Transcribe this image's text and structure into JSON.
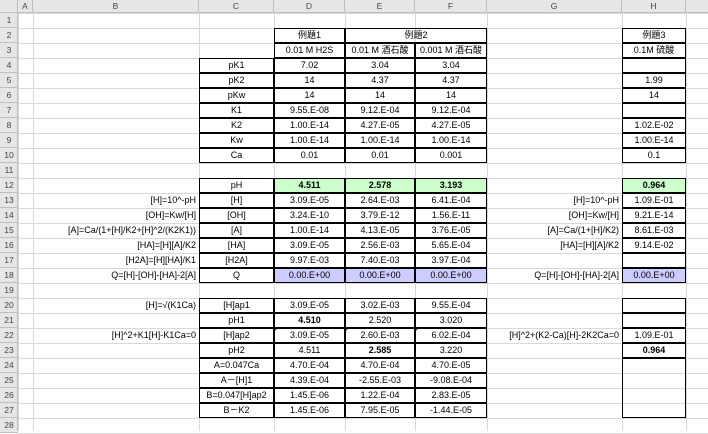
{
  "columns": [
    "A",
    "B",
    "C",
    "D",
    "E",
    "F",
    "G",
    "H"
  ],
  "rows": [
    "1",
    "2",
    "3",
    "4",
    "5",
    "6",
    "7",
    "8",
    "9",
    "10",
    "11",
    "12",
    "13",
    "14",
    "15",
    "16",
    "17",
    "18",
    "19",
    "20",
    "21",
    "22",
    "23",
    "24",
    "25",
    "26",
    "27",
    "28"
  ],
  "colors": {
    "green": "#ccffcc",
    "purple": "#ccccff",
    "comment_marker": "#1e7b34"
  },
  "cells": [
    {
      "ref": "D2",
      "text": "例題1",
      "align": "center"
    },
    {
      "ref": "E2",
      "text": "例題2",
      "align": "center",
      "span": 2
    },
    {
      "ref": "H2",
      "text": "例題3",
      "align": "center"
    },
    {
      "ref": "D3",
      "text": "0.01 M H2S",
      "align": "center"
    },
    {
      "ref": "E3",
      "text": "0.01 M 酒石酸",
      "align": "center"
    },
    {
      "ref": "F3",
      "text": "0.001 M 酒石酸",
      "align": "center"
    },
    {
      "ref": "H3",
      "text": "0.1M 硫酸",
      "align": "center"
    },
    {
      "ref": "C4",
      "text": "pK1",
      "align": "center"
    },
    {
      "ref": "D4",
      "text": "7.02",
      "align": "center"
    },
    {
      "ref": "E4",
      "text": "3.04",
      "align": "center"
    },
    {
      "ref": "F4",
      "text": "3.04",
      "align": "center"
    },
    {
      "ref": "C5",
      "text": "pK2",
      "align": "center"
    },
    {
      "ref": "D5",
      "text": "14",
      "align": "center"
    },
    {
      "ref": "E5",
      "text": "4.37",
      "align": "center"
    },
    {
      "ref": "F5",
      "text": "4.37",
      "align": "center"
    },
    {
      "ref": "H5",
      "text": "1.99",
      "align": "center"
    },
    {
      "ref": "C6",
      "text": "pKw",
      "align": "center"
    },
    {
      "ref": "D6",
      "text": "14",
      "align": "center"
    },
    {
      "ref": "E6",
      "text": "14",
      "align": "center"
    },
    {
      "ref": "F6",
      "text": "14",
      "align": "center"
    },
    {
      "ref": "H6",
      "text": "14",
      "align": "center"
    },
    {
      "ref": "C7",
      "text": "K1",
      "align": "center"
    },
    {
      "ref": "D7",
      "text": "9.55.E-08",
      "align": "center"
    },
    {
      "ref": "E7",
      "text": "9.12.E-04",
      "align": "center"
    },
    {
      "ref": "F7",
      "text": "9.12.E-04",
      "align": "center"
    },
    {
      "ref": "C8",
      "text": "K2",
      "align": "center"
    },
    {
      "ref": "D8",
      "text": "1.00.E-14",
      "align": "center"
    },
    {
      "ref": "E8",
      "text": "4.27.E-05",
      "align": "center"
    },
    {
      "ref": "F8",
      "text": "4.27.E-05",
      "align": "center"
    },
    {
      "ref": "H8",
      "text": "1.02.E-02",
      "align": "center"
    },
    {
      "ref": "C9",
      "text": "Kw",
      "align": "center"
    },
    {
      "ref": "D9",
      "text": "1.00.E-14",
      "align": "center"
    },
    {
      "ref": "E9",
      "text": "1.00.E-14",
      "align": "center"
    },
    {
      "ref": "F9",
      "text": "1.00.E-14",
      "align": "center"
    },
    {
      "ref": "H9",
      "text": "1.00.E-14",
      "align": "center"
    },
    {
      "ref": "C10",
      "text": "Ca",
      "align": "center"
    },
    {
      "ref": "D10",
      "text": "0.01",
      "align": "center"
    },
    {
      "ref": "E10",
      "text": "0.01",
      "align": "center"
    },
    {
      "ref": "F10",
      "text": "0.001",
      "align": "center"
    },
    {
      "ref": "H10",
      "text": "0.1",
      "align": "center"
    },
    {
      "ref": "C12",
      "text": "pH",
      "align": "center"
    },
    {
      "ref": "D12",
      "text": "4.511",
      "align": "center",
      "bold": true,
      "fill": "green"
    },
    {
      "ref": "E12",
      "text": "2.578",
      "align": "center",
      "bold": true,
      "fill": "green"
    },
    {
      "ref": "F12",
      "text": "3.193",
      "align": "center",
      "bold": true,
      "fill": "green"
    },
    {
      "ref": "H12",
      "text": "0.964",
      "align": "center",
      "bold": true,
      "fill": "green"
    },
    {
      "ref": "B13",
      "text": "[H]=10^-pH",
      "align": "right"
    },
    {
      "ref": "C13",
      "text": "[H]",
      "align": "center"
    },
    {
      "ref": "D13",
      "text": "3.09.E-05",
      "align": "center"
    },
    {
      "ref": "E13",
      "text": "2.64.E-03",
      "align": "center"
    },
    {
      "ref": "F13",
      "text": "6.41.E-04",
      "align": "center"
    },
    {
      "ref": "G13",
      "text": "[H]=10^-pH",
      "align": "right"
    },
    {
      "ref": "H13",
      "text": "1.09.E-01",
      "align": "center"
    },
    {
      "ref": "B14",
      "text": "[OH]=Kw/[H]",
      "align": "right"
    },
    {
      "ref": "C14",
      "text": "[OH]",
      "align": "center"
    },
    {
      "ref": "D14",
      "text": "3.24.E-10",
      "align": "center"
    },
    {
      "ref": "E14",
      "text": "3.79.E-12",
      "align": "center"
    },
    {
      "ref": "F14",
      "text": "1.56.E-11",
      "align": "center"
    },
    {
      "ref": "G14",
      "text": "[OH]=Kw/[H]",
      "align": "right"
    },
    {
      "ref": "H14",
      "text": "9.21.E-14",
      "align": "center"
    },
    {
      "ref": "B15",
      "text": "[A]=Ca/(1+[H]/K2+[H]^2/(K2K1))",
      "align": "right"
    },
    {
      "ref": "C15",
      "text": "[A]",
      "align": "center"
    },
    {
      "ref": "D15",
      "text": "1.00.E-14",
      "align": "center"
    },
    {
      "ref": "E15",
      "text": "4.13.E-05",
      "align": "center"
    },
    {
      "ref": "F15",
      "text": "3.76.E-05",
      "align": "center"
    },
    {
      "ref": "G15",
      "text": "[A]=Ca/(1+[H]/K2)",
      "align": "right"
    },
    {
      "ref": "H15",
      "text": "8.61.E-03",
      "align": "center"
    },
    {
      "ref": "B16",
      "text": "[HA]=[H][A]/K2",
      "align": "right"
    },
    {
      "ref": "C16",
      "text": "[HA]",
      "align": "center"
    },
    {
      "ref": "D16",
      "text": "3.09.E-05",
      "align": "center"
    },
    {
      "ref": "E16",
      "text": "2.56.E-03",
      "align": "center"
    },
    {
      "ref": "F16",
      "text": "5.65.E-04",
      "align": "center"
    },
    {
      "ref": "G16",
      "text": "[HA]=[H][A]/K2",
      "align": "right"
    },
    {
      "ref": "H16",
      "text": "9.14.E-02",
      "align": "center"
    },
    {
      "ref": "B17",
      "text": "[H2A]=[H][HA]/K1",
      "align": "right"
    },
    {
      "ref": "C17",
      "text": "[H2A]",
      "align": "center"
    },
    {
      "ref": "D17",
      "text": "9.97.E-03",
      "align": "center"
    },
    {
      "ref": "E17",
      "text": "7.40.E-03",
      "align": "center"
    },
    {
      "ref": "F17",
      "text": "3.97.E-04",
      "align": "center"
    },
    {
      "ref": "B18",
      "text": "Q=[H]-[OH]-[HA]-2[A]",
      "align": "right"
    },
    {
      "ref": "C18",
      "text": "Q",
      "align": "center"
    },
    {
      "ref": "D18",
      "text": "0.00.E+00",
      "align": "center",
      "fill": "purple"
    },
    {
      "ref": "E18",
      "text": "0.00.E+00",
      "align": "center",
      "fill": "purple"
    },
    {
      "ref": "F18",
      "text": "0.00.E+00",
      "align": "center",
      "fill": "purple"
    },
    {
      "ref": "G18",
      "text": "Q=[H]-[OH]-[HA]-2[A]",
      "align": "right"
    },
    {
      "ref": "H18",
      "text": "0.00.E+00",
      "align": "center",
      "fill": "purple"
    },
    {
      "ref": "B20",
      "text": "[H]=√(K1Ca)",
      "align": "right"
    },
    {
      "ref": "C20",
      "text": "[H]ap1",
      "align": "center"
    },
    {
      "ref": "D20",
      "text": "3.09.E-05",
      "align": "center"
    },
    {
      "ref": "E20",
      "text": "3.02.E-03",
      "align": "center"
    },
    {
      "ref": "F20",
      "text": "9.55.E-04",
      "align": "center"
    },
    {
      "ref": "C21",
      "text": "pH1",
      "align": "center"
    },
    {
      "ref": "D21",
      "text": "4.510",
      "align": "center",
      "bold": true
    },
    {
      "ref": "E21",
      "text": "2.520",
      "align": "center"
    },
    {
      "ref": "F21",
      "text": "3.020",
      "align": "center"
    },
    {
      "ref": "B22",
      "text": "[H]^2+K1[H]-K1Ca=0",
      "align": "right"
    },
    {
      "ref": "C22",
      "text": "[H]ap2",
      "align": "center"
    },
    {
      "ref": "D22",
      "text": "3.09.E-05",
      "align": "center",
      "marker": true
    },
    {
      "ref": "E22",
      "text": "2.60.E-03",
      "align": "center",
      "marker": true
    },
    {
      "ref": "F22",
      "text": "6.02.E-04",
      "align": "center",
      "marker": true
    },
    {
      "ref": "G22",
      "text": "[H]^2+(K2-Ca)[H]-2K2Ca=0",
      "align": "right"
    },
    {
      "ref": "H22",
      "text": "1.09.E-01",
      "align": "center"
    },
    {
      "ref": "C23",
      "text": "pH2",
      "align": "center"
    },
    {
      "ref": "D23",
      "text": "4.511",
      "align": "center"
    },
    {
      "ref": "E23",
      "text": "2.585",
      "align": "center",
      "bold": true
    },
    {
      "ref": "F23",
      "text": "3.220",
      "align": "center"
    },
    {
      "ref": "H23",
      "text": "0.964",
      "align": "center",
      "bold": true
    },
    {
      "ref": "C24",
      "text": "A=0.047Ca",
      "align": "center"
    },
    {
      "ref": "D24",
      "text": "4.70.E-04",
      "align": "center"
    },
    {
      "ref": "E24",
      "text": "4.70.E-04",
      "align": "center"
    },
    {
      "ref": "F24",
      "text": "4.70.E-05",
      "align": "center"
    },
    {
      "ref": "C25",
      "text": "A－[H]1",
      "align": "center"
    },
    {
      "ref": "D25",
      "text": "4.39.E-04",
      "align": "center"
    },
    {
      "ref": "E25",
      "text": "-2.55.E-03",
      "align": "center"
    },
    {
      "ref": "F25",
      "text": "-9.08.E-04",
      "align": "center"
    },
    {
      "ref": "C26",
      "text": "B=0.047[H]ap2",
      "align": "center"
    },
    {
      "ref": "D26",
      "text": "1.45.E-06",
      "align": "center"
    },
    {
      "ref": "E26",
      "text": "1.22.E-04",
      "align": "center"
    },
    {
      "ref": "F26",
      "text": "2.83.E-05",
      "align": "center"
    },
    {
      "ref": "C27",
      "text": "B－K2",
      "align": "center"
    },
    {
      "ref": "D27",
      "text": "1.45.E-06",
      "align": "center"
    },
    {
      "ref": "E27",
      "text": "7.95.E-05",
      "align": "center"
    },
    {
      "ref": "F27",
      "text": "-1.44.E-05",
      "align": "center"
    }
  ]
}
